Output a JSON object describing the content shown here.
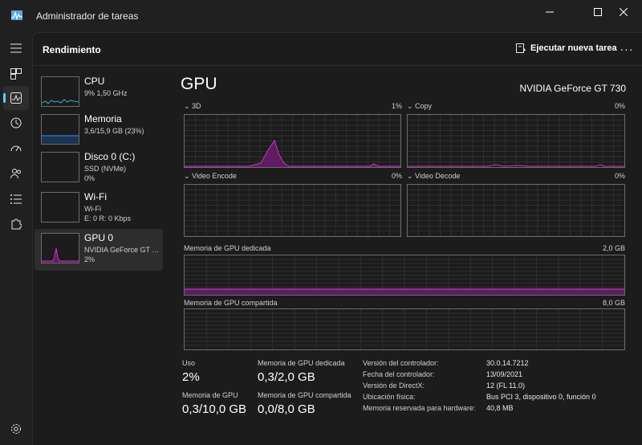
{
  "app": {
    "title": "Administrador de tareas"
  },
  "header": {
    "page_title": "Rendimiento",
    "run_task_label": "Ejecutar nueva tarea",
    "more_label": "···"
  },
  "sidebar": {
    "items": [
      {
        "name": "CPU",
        "sub1": "9%  1,50 GHz",
        "sub2": ""
      },
      {
        "name": "Memoria",
        "sub1": "3,6/15,9 GB (23%)",
        "sub2": ""
      },
      {
        "name": "Disco 0 (C:)",
        "sub1": "SSD (NVMe)",
        "sub2": "0%"
      },
      {
        "name": "Wi-Fi",
        "sub1": "Wi-Fi",
        "sub2": "E: 0 R: 0 Kbps"
      },
      {
        "name": "GPU 0",
        "sub1": "NVIDIA GeForce GT 730",
        "sub2": "2%"
      }
    ]
  },
  "gpu": {
    "title": "GPU",
    "model": "NVIDIA GeForce GT 730",
    "engines": [
      {
        "label": "3D",
        "value": "1%"
      },
      {
        "label": "Copy",
        "value": "0%"
      },
      {
        "label": "Video Encode",
        "value": "0%"
      },
      {
        "label": "Video Decode",
        "value": "0%"
      }
    ],
    "dedicated": {
      "label": "Memoria de GPU dedicada",
      "max": "2,0 GB"
    },
    "shared": {
      "label": "Memoria de GPU compartida",
      "max": "8,0 GB"
    }
  },
  "stats": {
    "usage_label": "Uso",
    "usage_value": "2%",
    "dedicated_label": "Memoria de GPU dedicada",
    "dedicated_value": "0,3/2,0 GB",
    "gpu_mem_label": "Memoria de GPU",
    "gpu_mem_value": "0,3/10,0 GB",
    "shared_label": "Memoria de GPU compartida",
    "shared_value": "0,0/8,0 GB"
  },
  "info": {
    "driver_version_label": "Versión del controlador:",
    "driver_version": "30.0.14.7212",
    "driver_date_label": "Fecha del controlador:",
    "driver_date": "13/09/2021",
    "directx_label": "Versión de DirectX:",
    "directx": "12 (FL 11.0)",
    "location_label": "Ubicación física:",
    "location": "Bus PCI 3, dispositivo 0, función 0",
    "reserved_label": "Memoria reservada para hardware:",
    "reserved": "40,8 MB"
  },
  "colors": {
    "accent": "#60cdff",
    "gpu_line": "#c238c2",
    "gpu_fill": "#5e1d5e",
    "mem_line": "#2f6fb0",
    "cpu_line": "#3aa7c7",
    "grid": "#2f2f2f"
  }
}
